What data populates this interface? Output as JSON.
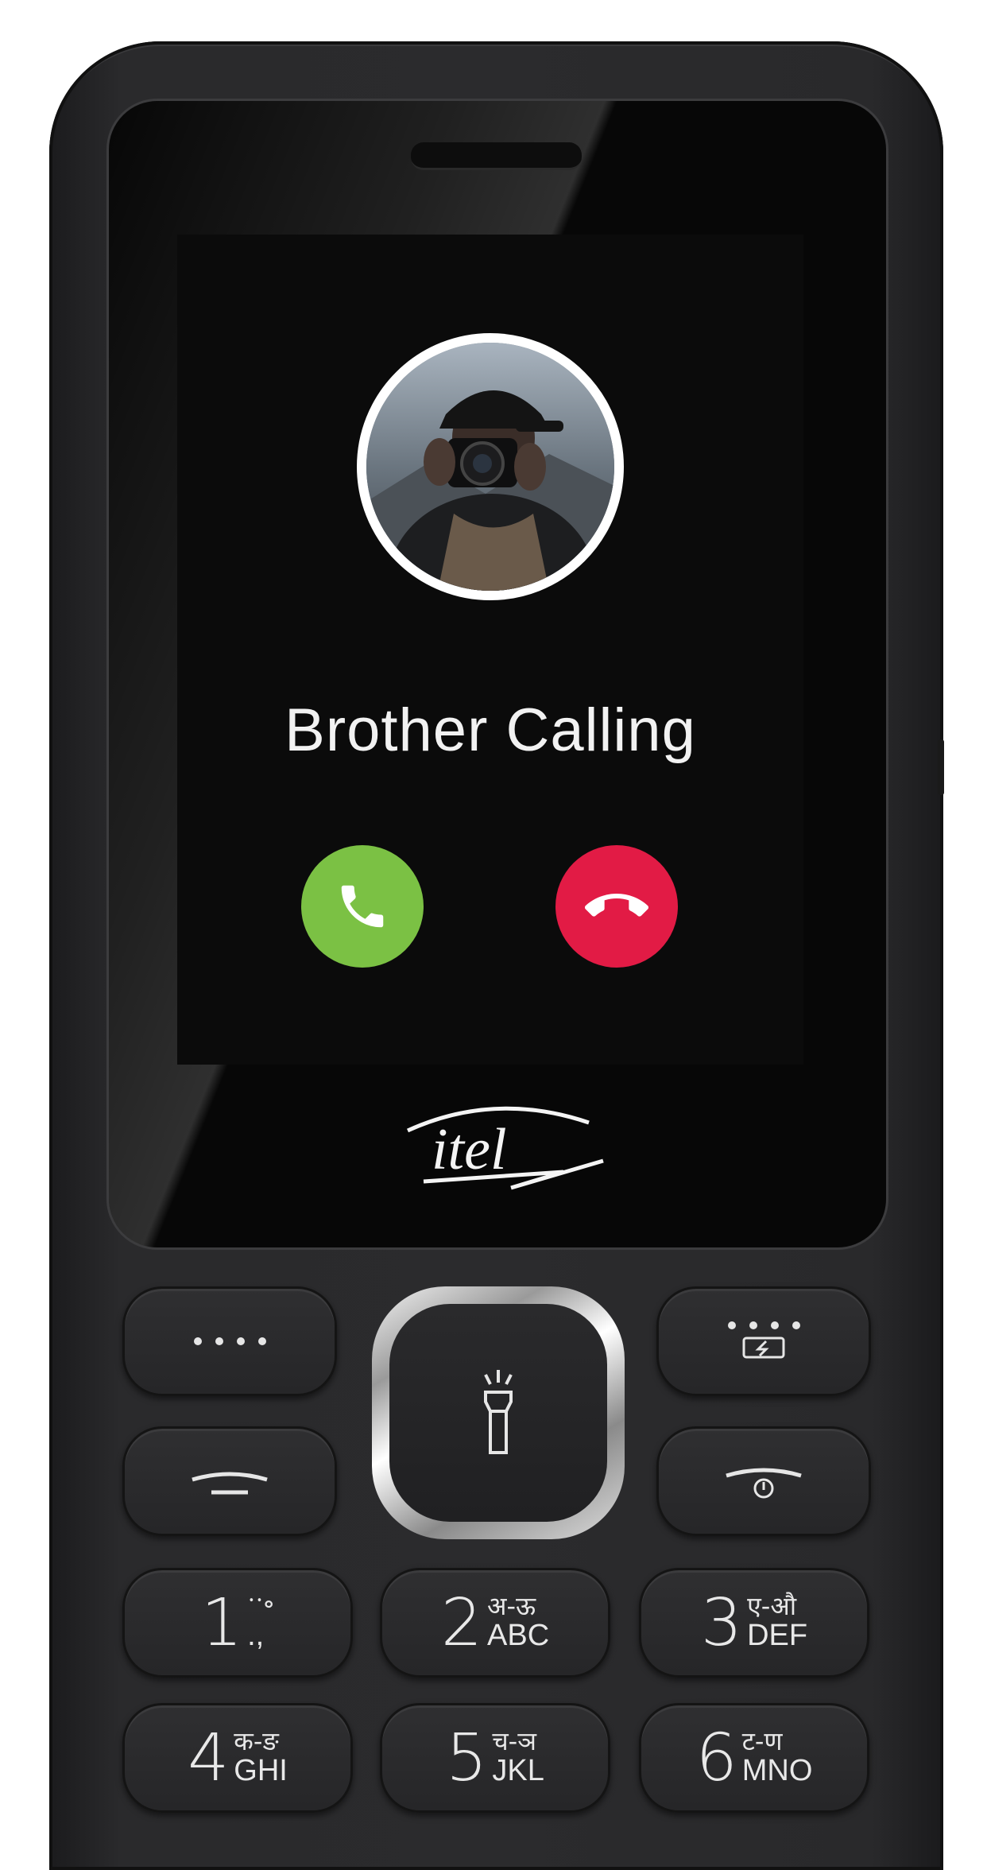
{
  "screen": {
    "caller_text": "Brother Calling",
    "accept_icon": "phone-answer-icon",
    "decline_icon": "phone-hangup-icon",
    "accept_color": "#7bc144",
    "decline_color": "#e21b45"
  },
  "brand": {
    "logo_text": "itel"
  },
  "function_keys": {
    "left_soft_icon": "dots-icon",
    "right_soft_icon": "battery-dots-icon",
    "call_icon": "call-key-icon",
    "end_icon": "power-end-icon",
    "center_icon": "flashlight-icon"
  },
  "numpad": [
    {
      "digit": "1",
      "top": "ॱॱ॰",
      "bottom": ".,"
    },
    {
      "digit": "2",
      "top": "अ-ऊ",
      "bottom": "ABC"
    },
    {
      "digit": "3",
      "top": "ए-औ",
      "bottom": "DEF"
    },
    {
      "digit": "4",
      "top": "क-ङ",
      "bottom": "GHI"
    },
    {
      "digit": "5",
      "top": "च-ञ",
      "bottom": "JKL"
    },
    {
      "digit": "6",
      "top": "ट-ण",
      "bottom": "MNO"
    }
  ]
}
